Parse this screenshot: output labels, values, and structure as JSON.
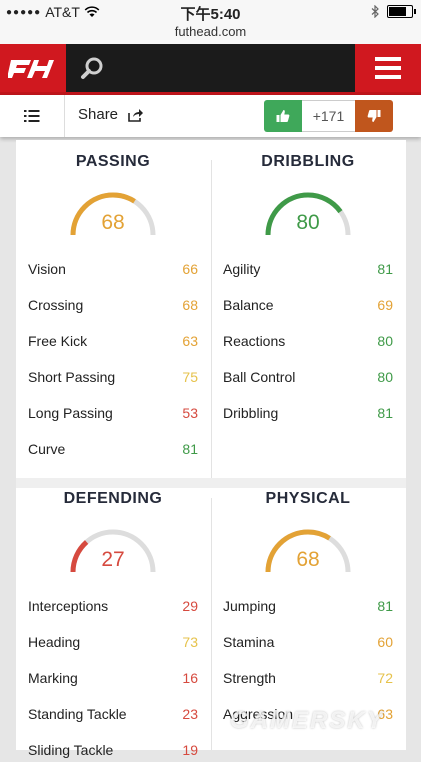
{
  "status": {
    "carrier": "AT&T",
    "time": "下午5:40",
    "url": "futhead.com"
  },
  "colors": {
    "orange": "#e3a235",
    "green": "#3f9a48",
    "red": "#d64a3f",
    "yellow": "#e6c24b",
    "track": "#dddddd",
    "brand": "#d0181f"
  },
  "toolbar": {
    "share_label": "Share",
    "vote_count": "+171"
  },
  "sections": [
    {
      "key": "passing",
      "title": "PASSING",
      "value": 68,
      "color": "#e3a235",
      "stats": [
        {
          "name": "Vision",
          "value": 66,
          "color": "#e3a235"
        },
        {
          "name": "Crossing",
          "value": 68,
          "color": "#e3a235"
        },
        {
          "name": "Free Kick",
          "value": 63,
          "color": "#e3a235"
        },
        {
          "name": "Short Passing",
          "value": 75,
          "color": "#e6c24b"
        },
        {
          "name": "Long Passing",
          "value": 53,
          "color": "#d64a3f"
        },
        {
          "name": "Curve",
          "value": 81,
          "color": "#3f9a48"
        }
      ]
    },
    {
      "key": "dribbling",
      "title": "DRIBBLING",
      "value": 80,
      "color": "#3f9a48",
      "stats": [
        {
          "name": "Agility",
          "value": 81,
          "color": "#3f9a48"
        },
        {
          "name": "Balance",
          "value": 69,
          "color": "#e3a235"
        },
        {
          "name": "Reactions",
          "value": 80,
          "color": "#3f9a48"
        },
        {
          "name": "Ball Control",
          "value": 80,
          "color": "#3f9a48"
        },
        {
          "name": "Dribbling",
          "value": 81,
          "color": "#3f9a48"
        }
      ]
    },
    {
      "key": "defending",
      "title": "DEFENDING",
      "value": 27,
      "color": "#d64a3f",
      "stats": [
        {
          "name": "Interceptions",
          "value": 29,
          "color": "#d64a3f"
        },
        {
          "name": "Heading",
          "value": 73,
          "color": "#e6c24b"
        },
        {
          "name": "Marking",
          "value": 16,
          "color": "#d64a3f"
        },
        {
          "name": "Standing Tackle",
          "value": 23,
          "color": "#d64a3f"
        },
        {
          "name": "Sliding Tackle",
          "value": 19,
          "color": "#d64a3f"
        }
      ]
    },
    {
      "key": "physical",
      "title": "PHYSICAL",
      "value": 68,
      "color": "#e3a235",
      "stats": [
        {
          "name": "Jumping",
          "value": 81,
          "color": "#3f9a48"
        },
        {
          "name": "Stamina",
          "value": 60,
          "color": "#e3a235"
        },
        {
          "name": "Strength",
          "value": 72,
          "color": "#e6c24b"
        },
        {
          "name": "Aggression",
          "value": 63,
          "color": "#e3a235"
        }
      ]
    }
  ],
  "watermark": "GAMERSKY"
}
